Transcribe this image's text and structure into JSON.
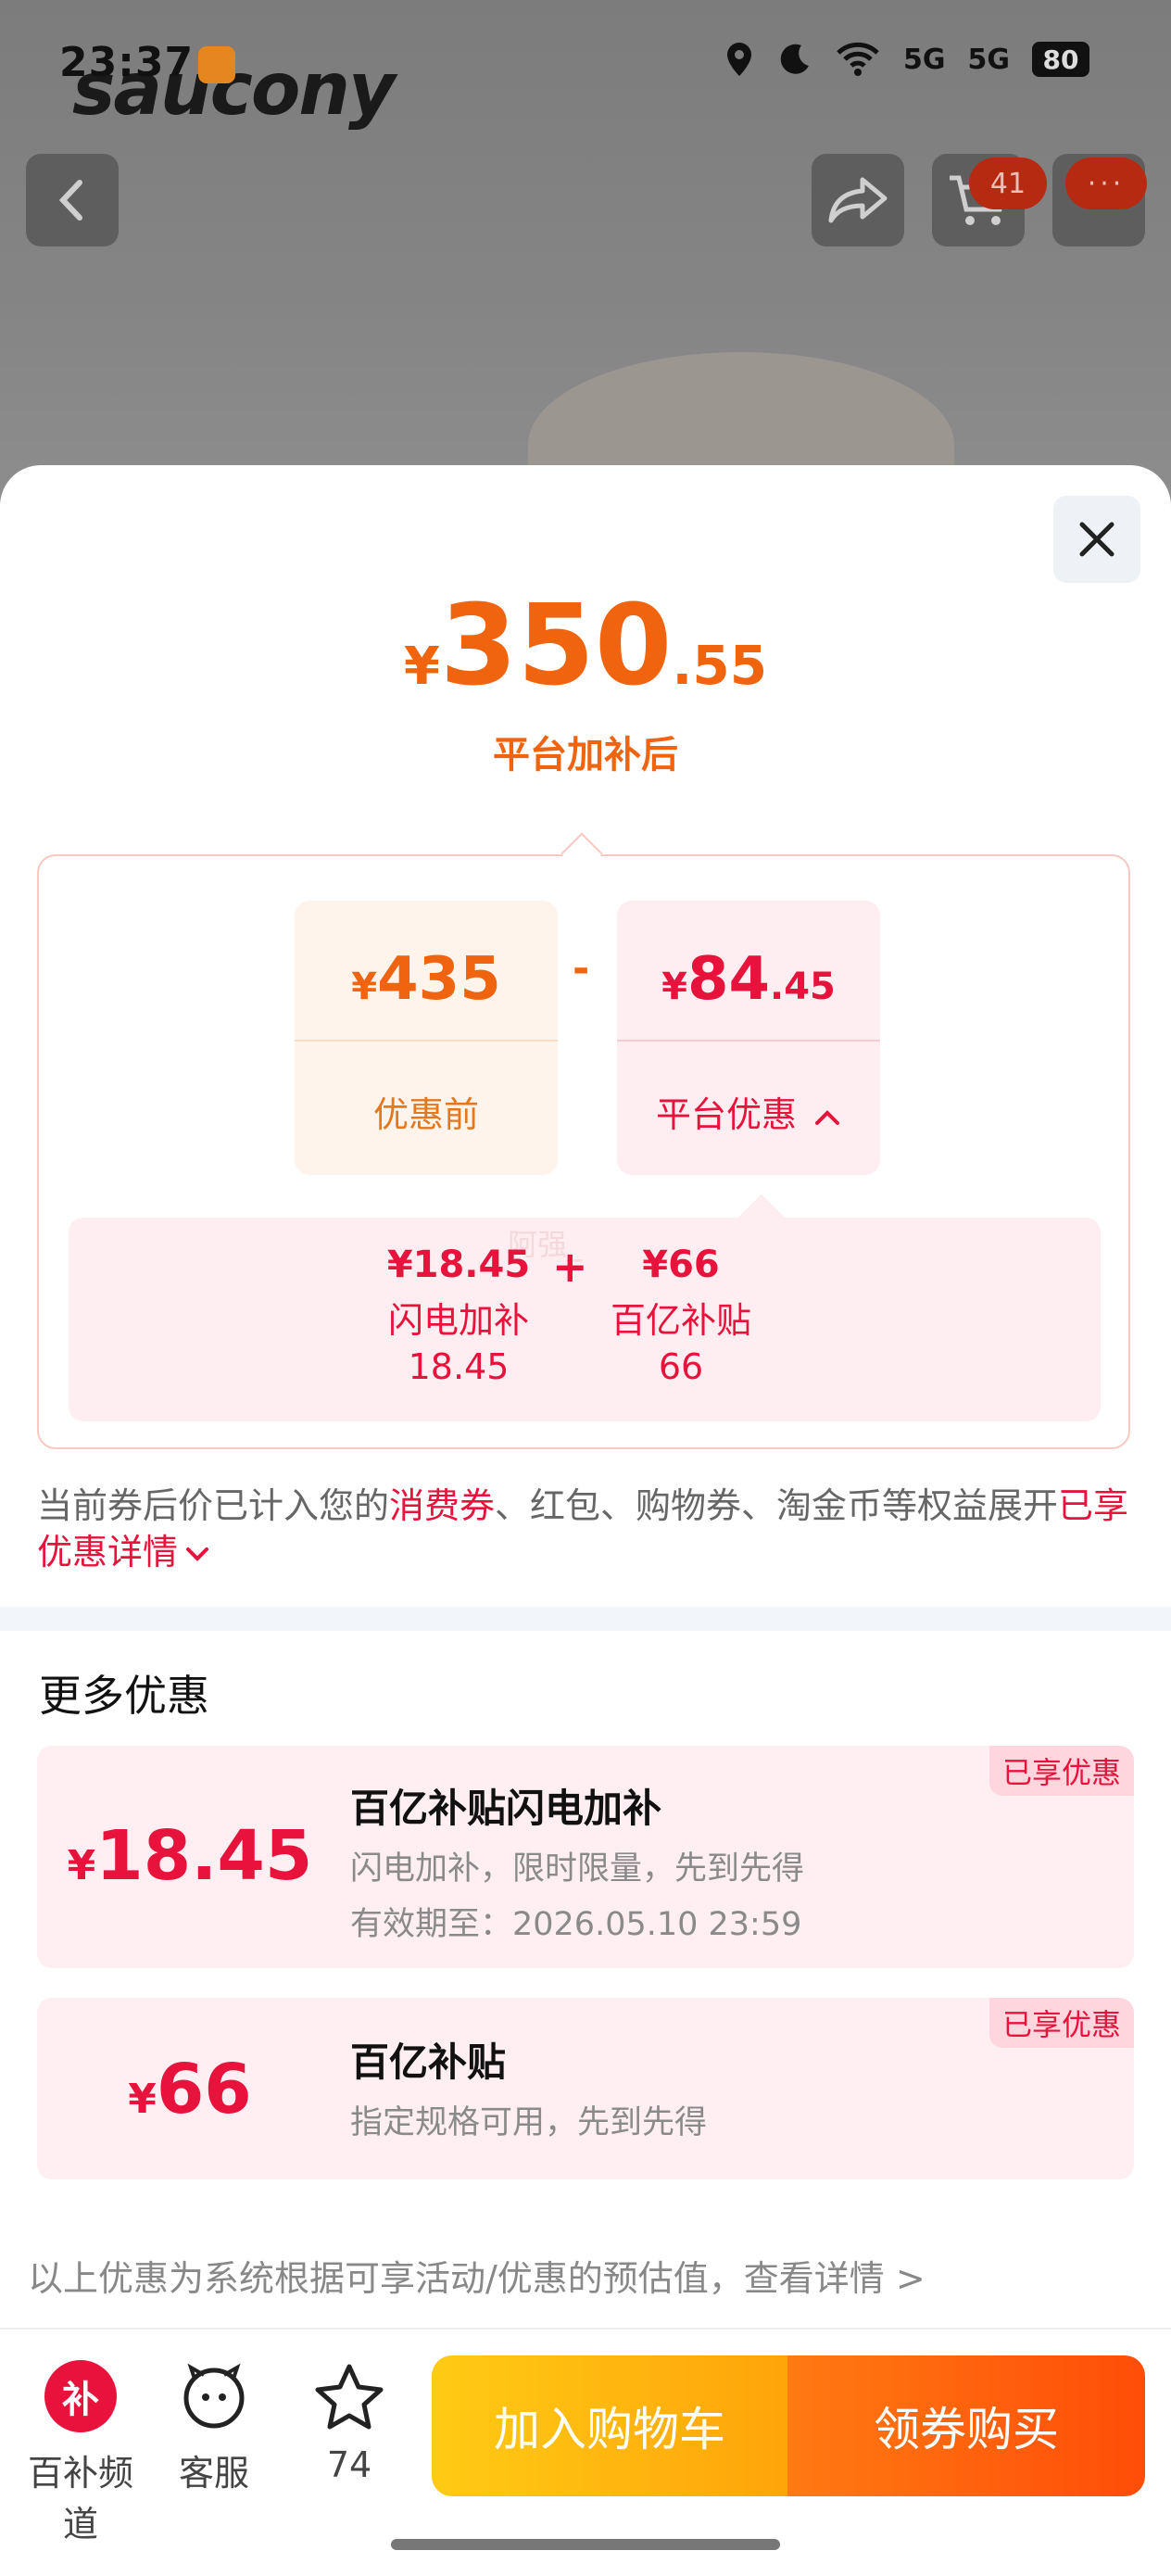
{
  "status_bar": {
    "time": "23:37",
    "network_1": "5G",
    "network_2": "5G",
    "battery": "80"
  },
  "background": {
    "brand": "saucony",
    "cart_count": "41",
    "more_label": "···"
  },
  "sheet": {
    "final_price": {
      "currency": "¥",
      "integer": "350",
      "decimal": ".55",
      "label": "平台加补后"
    },
    "original": {
      "currency": "¥",
      "value": "435",
      "label": "优惠前"
    },
    "operator": "-",
    "discount": {
      "currency": "¥",
      "integer": "84",
      "decimal": ".45",
      "label": "平台优惠"
    },
    "breakdown": {
      "watermark": "阿强_",
      "plus": "+",
      "items": [
        {
          "amount": "¥18.45",
          "name": "闪电加补",
          "value": "18.45"
        },
        {
          "amount": "¥66",
          "name": "百亿补贴",
          "value": "66"
        }
      ]
    },
    "note": {
      "part1": "当前券后价已计入您的",
      "highlight1": "消费券",
      "part2": "、红包、购物券、淘金币等权益展开",
      "highlight2": "已享优惠详情"
    },
    "more_title": "更多优惠",
    "offers": [
      {
        "currency": "¥",
        "amount": "18.45",
        "title": "百亿补贴闪电加补",
        "desc": "闪电加补，限时限量，先到先得",
        "validity": "有效期至：2026.05.10 23:59",
        "tag": "已享优惠"
      },
      {
        "currency": "¥",
        "amount": "66",
        "title": "百亿补贴",
        "desc": "指定规格可用，先到先得",
        "tag": "已享优惠"
      }
    ],
    "footnote": "以上优惠为系统根据可享活动/优惠的预估值，查看详情 >"
  },
  "bottom_bar": {
    "channel_icon_text": "补",
    "channel": "百补频道",
    "service": "客服",
    "favorite_count": "74",
    "add_to_cart": "加入购物车",
    "buy": "领券购买"
  },
  "colors": {
    "orange": "#f06410",
    "red": "#e8133c",
    "cart_gradient": "#ffcb14",
    "buy_gradient": "#ff4d08"
  }
}
